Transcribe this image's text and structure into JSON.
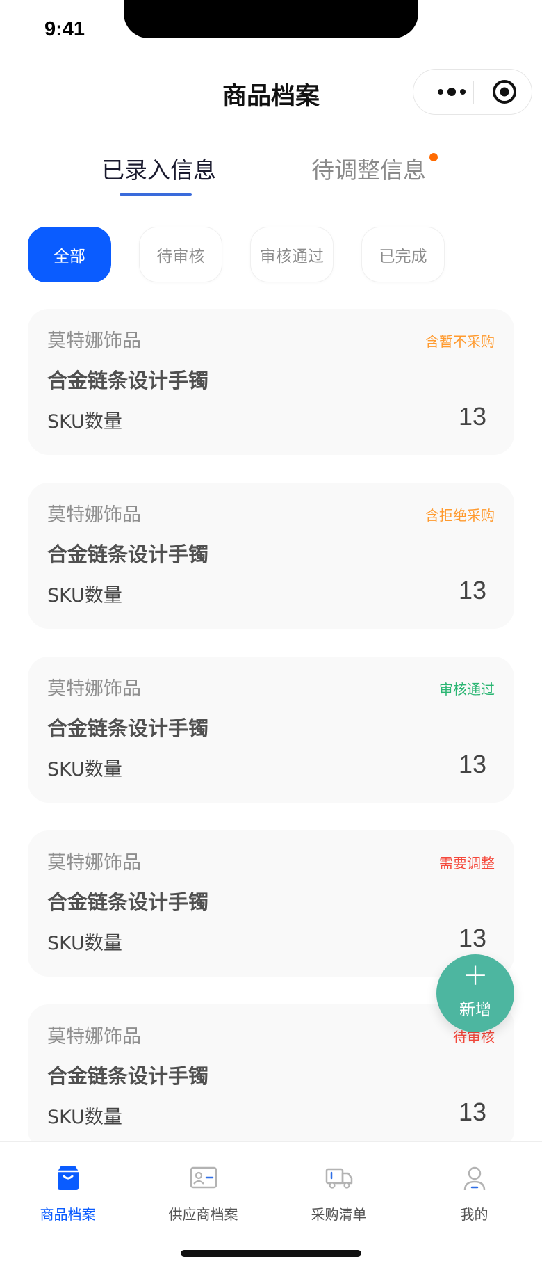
{
  "status_bar": {
    "time": "9:41"
  },
  "nav": {
    "title": "商品档案"
  },
  "main_tabs": [
    {
      "label": "已录入信息",
      "active": true
    },
    {
      "label": "待调整信息",
      "active": false,
      "has_dot": true
    }
  ],
  "filters": [
    {
      "label": "全部",
      "active": true
    },
    {
      "label": "待审核",
      "active": false
    },
    {
      "label": "审核通过",
      "active": false
    },
    {
      "label": "已完成",
      "active": false
    }
  ],
  "cards": [
    {
      "supplier": "莫特娜饰品",
      "status": "含暂不采购",
      "status_color": "#ff9a2e",
      "product": "合金链条设计手镯",
      "sku_label": "SKU数量",
      "sku_count": "13"
    },
    {
      "supplier": "莫特娜饰品",
      "status": "含拒绝采购",
      "status_color": "#ff9a2e",
      "product": "合金链条设计手镯",
      "sku_label": "SKU数量",
      "sku_count": "13"
    },
    {
      "supplier": "莫特娜饰品",
      "status": "审核通过",
      "status_color": "#2bb673",
      "product": "合金链条设计手镯",
      "sku_label": "SKU数量",
      "sku_count": "13"
    },
    {
      "supplier": "莫特娜饰品",
      "status": "需要调整",
      "status_color": "#f5483b",
      "product": "合金链条设计手镯",
      "sku_label": "SKU数量",
      "sku_count": "13"
    },
    {
      "supplier": "莫特娜饰品",
      "status": "待审核",
      "status_color": "#f5483b",
      "product": "合金链条设计手镯",
      "sku_label": "SKU数量",
      "sku_count": "13"
    }
  ],
  "fab": {
    "label": "新增",
    "icon": "plus-icon"
  },
  "tabbar": [
    {
      "label": "商品档案",
      "icon": "archive-box-icon",
      "active": true
    },
    {
      "label": "供应商档案",
      "icon": "id-card-icon",
      "active": false
    },
    {
      "label": "采购清单",
      "icon": "truck-icon",
      "active": false
    },
    {
      "label": "我的",
      "icon": "user-icon",
      "active": false
    }
  ],
  "colors": {
    "primary": "#0a5cff",
    "fab": "#4db6a0",
    "card_bg": "#f9f9f9",
    "tab_underline": "#3a6bdb",
    "tab_dot": "#ff6a00"
  }
}
